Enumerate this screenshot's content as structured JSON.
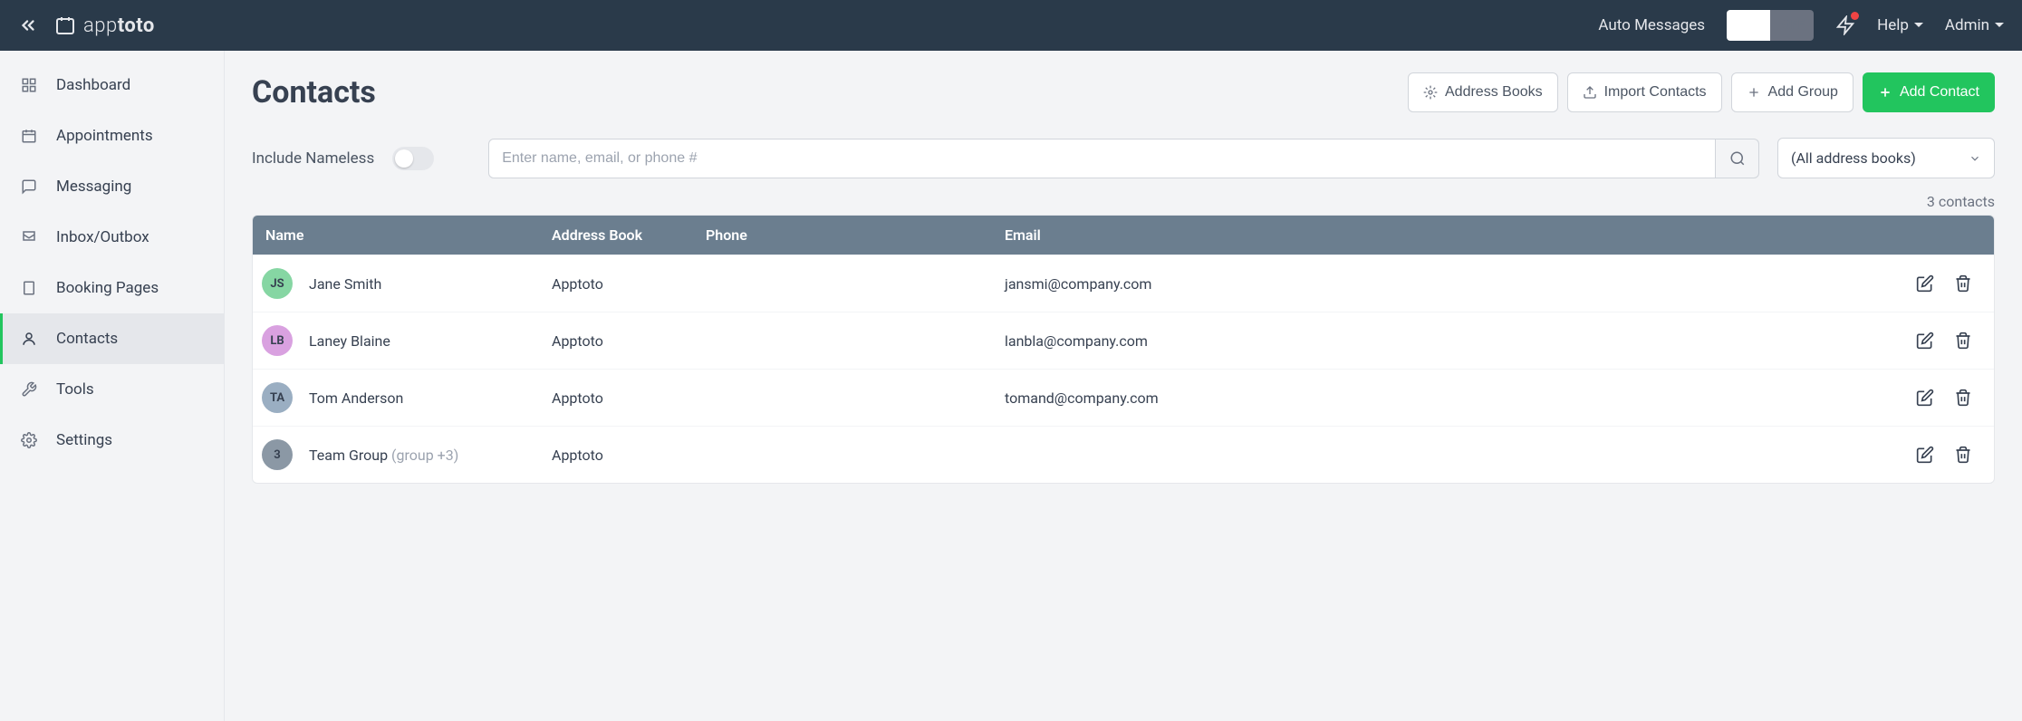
{
  "topbar": {
    "auto_messages_label": "Auto Messages",
    "toggle_off": "OFF",
    "help_label": "Help",
    "admin_label": "Admin"
  },
  "sidebar": {
    "items": [
      {
        "label": "Dashboard"
      },
      {
        "label": "Appointments"
      },
      {
        "label": "Messaging"
      },
      {
        "label": "Inbox/Outbox"
      },
      {
        "label": "Booking Pages"
      },
      {
        "label": "Contacts"
      },
      {
        "label": "Tools"
      },
      {
        "label": "Settings"
      }
    ]
  },
  "page": {
    "title": "Contacts",
    "actions": {
      "address_books": "Address Books",
      "import_contacts": "Import Contacts",
      "add_group": "Add Group",
      "add_contact": "Add Contact"
    },
    "include_nameless": "Include Nameless",
    "search_placeholder": "Enter name, email, or phone #",
    "book_filter": "(All address books)",
    "count": "3 contacts"
  },
  "columns": {
    "name": "Name",
    "address_book": "Address Book",
    "phone": "Phone",
    "email": "Email"
  },
  "rows": [
    {
      "initials": "JS",
      "color": "#86d6a3",
      "name": "Jane Smith",
      "suffix": "",
      "book": "Apptoto",
      "phone": "",
      "email": "jansmi@company.com"
    },
    {
      "initials": "LB",
      "color": "#d9a1e0",
      "name": "Laney Blaine",
      "suffix": "",
      "book": "Apptoto",
      "phone": "",
      "email": "lanbla@company.com"
    },
    {
      "initials": "TA",
      "color": "#9aaec2",
      "name": "Tom Anderson",
      "suffix": "",
      "book": "Apptoto",
      "phone": "",
      "email": "tomand@company.com"
    },
    {
      "initials": "3",
      "color": "#8b98a5",
      "name": "Team Group",
      "suffix": "(group +3)",
      "book": "Apptoto",
      "phone": "",
      "email": ""
    }
  ]
}
